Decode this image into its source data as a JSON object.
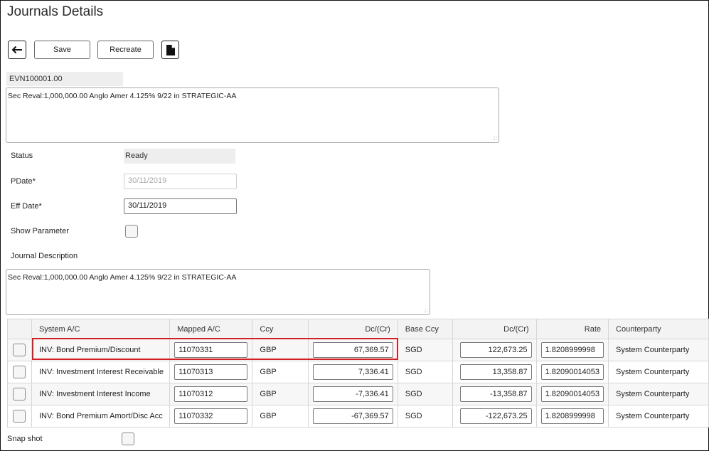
{
  "page": {
    "title": "Journals Details"
  },
  "toolbar": {
    "back_icon": "arrow-left-icon",
    "save_label": "Save",
    "recreate_label": "Recreate",
    "document_icon": "document-icon"
  },
  "journal": {
    "id": "EVN100001.00",
    "narrative": "Sec Reval:1,000,000.00 Anglo Amer 4.125% 9/22 in STRATEGIC-AA",
    "status_label": "Status",
    "status_value": "Ready",
    "pdate_label": "PDate*",
    "pdate_value": "30/11/2019",
    "effdate_label": "Eff Date*",
    "effdate_value": "30/11/2019",
    "show_parameter_label": "Show Parameter",
    "show_parameter_checked": false,
    "description_label": "Journal Description",
    "description_value": "Sec Reval:1,000,000.00 Anglo Amer 4.125% 9/22 in STRATEGIC-AA"
  },
  "table": {
    "headers": [
      "System A/C",
      "Mapped A/C",
      "Ccy",
      "Dc/(Cr)",
      "Base Ccy",
      "Dc/(Cr)",
      "Rate",
      "Counterparty"
    ],
    "rows": [
      {
        "system_ac": "INV: Bond Premium/Discount",
        "mapped_ac": "11070331",
        "ccy": "GBP",
        "dc": "67,369.57",
        "base_ccy": "SGD",
        "base_dc": "122,673.25",
        "rate": "1.8208999998",
        "counterparty": "System Counterparty",
        "highlighted": true
      },
      {
        "system_ac": "INV: Investment Interest Receivable",
        "mapped_ac": "11070313",
        "ccy": "GBP",
        "dc": "7,336.41",
        "base_ccy": "SGD",
        "base_dc": "13,358.87",
        "rate": "1.82090014053",
        "counterparty": "System Counterparty",
        "highlighted": false
      },
      {
        "system_ac": "INV: Investment Interest Income",
        "mapped_ac": "11070312",
        "ccy": "GBP",
        "dc": "-7,336.41",
        "base_ccy": "SGD",
        "base_dc": "-13,358.87",
        "rate": "1.82090014053",
        "counterparty": "System Counterparty",
        "highlighted": false
      },
      {
        "system_ac": "INV: Bond Premium Amort/Disc Acc",
        "mapped_ac": "11070332",
        "ccy": "GBP",
        "dc": "-67,369.57",
        "base_ccy": "SGD",
        "base_dc": "-122,673.25",
        "rate": "1.8208999998",
        "counterparty": "System Counterparty",
        "highlighted": false
      }
    ]
  },
  "footer": {
    "snapshot_label": "Snap shot",
    "snapshot_checked": false
  },
  "colors": {
    "highlight": "#d32026"
  }
}
